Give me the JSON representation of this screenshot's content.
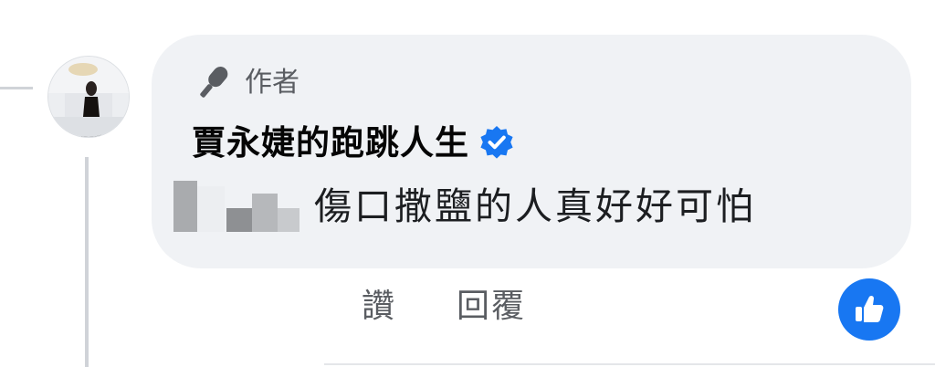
{
  "comment": {
    "author_badge_label": "作者",
    "page_name": "賈永婕的跑跳人生",
    "text": "傷口撒鹽的人真好好可怕"
  },
  "actions": {
    "like_label": "讚",
    "reply_label": "回覆"
  },
  "icons": {
    "badge_icon": "microphone-icon",
    "verified_icon": "verified-check-icon",
    "reaction_icon": "thumbs-up-icon"
  },
  "colors": {
    "bubble_bg": "#f0f2f5",
    "verified_blue": "#1877f2",
    "secondary_text": "#5a5d62",
    "primary_text": "#050505"
  }
}
